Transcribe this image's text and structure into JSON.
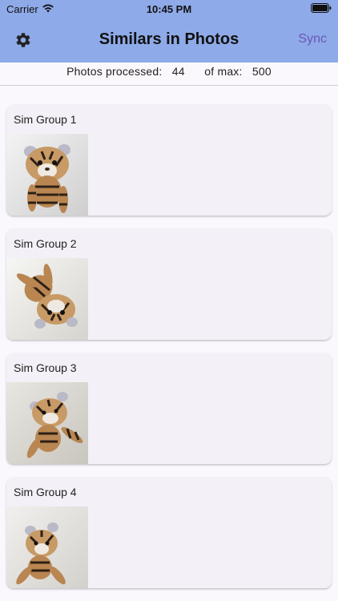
{
  "status_bar": {
    "carrier": "Carrier",
    "time": "10:45 PM",
    "icons": [
      "wifi-icon",
      "battery-icon"
    ]
  },
  "header": {
    "title": "Similars in Photos",
    "left_icon": "gear-icon",
    "sync_label": "Sync",
    "background_color": "#8eaae8",
    "accent_color": "#6a57b8"
  },
  "info": {
    "processed_label": "Photos processed:",
    "processed_value": "44",
    "max_label": "of max:",
    "max_value": "500"
  },
  "groups": [
    {
      "label": "Sim Group 1"
    },
    {
      "label": "Sim Group 2"
    },
    {
      "label": "Sim Group 3"
    },
    {
      "label": "Sim Group 4"
    }
  ]
}
